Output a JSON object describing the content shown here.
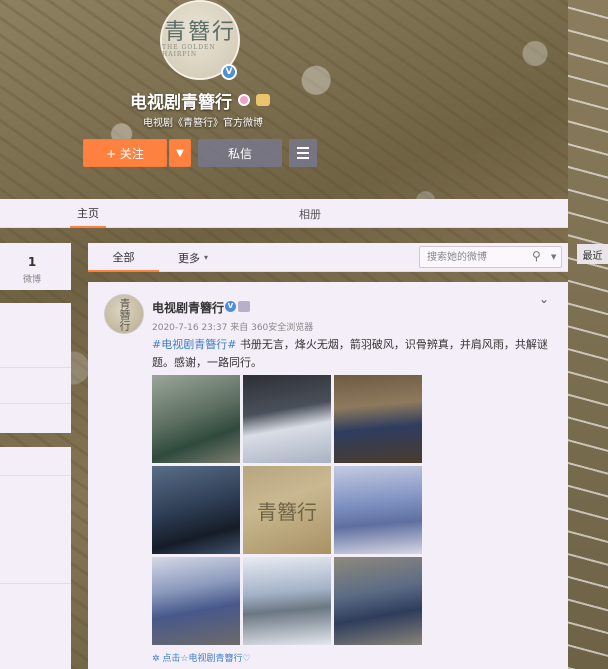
{
  "header": {
    "logo_title": "青簪行",
    "logo_subtitle": "THE GOLDEN HAIRPIN",
    "verified_mark": "V",
    "profile_name": "电视剧青簪行",
    "profile_desc": "电视剧《青簪行》官方微博",
    "follow_label": "+ 关注",
    "follow_more_symbol": "▼",
    "message_label": "私信"
  },
  "tabs": {
    "home": "主页",
    "album": "相册"
  },
  "left": {
    "weibo_count": "1",
    "weibo_label": "微博"
  },
  "feed_filter": {
    "all": "全部",
    "more": "更多",
    "more_icon": "▾",
    "search_placeholder": "搜索她的微博",
    "search_icon": "⚲",
    "search_caret": "▼"
  },
  "side": {
    "recent_label": "最近"
  },
  "post": {
    "avatar_text": "青簪行",
    "name": "电视剧青簪行",
    "verified_mark": "V",
    "caret": "⌄",
    "meta": "2020-7-16 23:37 来自 360安全浏览器",
    "tag": "#电视剧青簪行#",
    "text": " 书册无言，烽火无烟，箭羽破风，识骨辨真，并肩风雨，共解谜题。感谢，一路同行。",
    "center_photo_text": "青簪行",
    "source": "✲ 点击☆电视剧青簪行♡"
  },
  "colors": {
    "accent": "#ff8140",
    "link": "#3d7fc9",
    "panel": "#f4eef8"
  }
}
